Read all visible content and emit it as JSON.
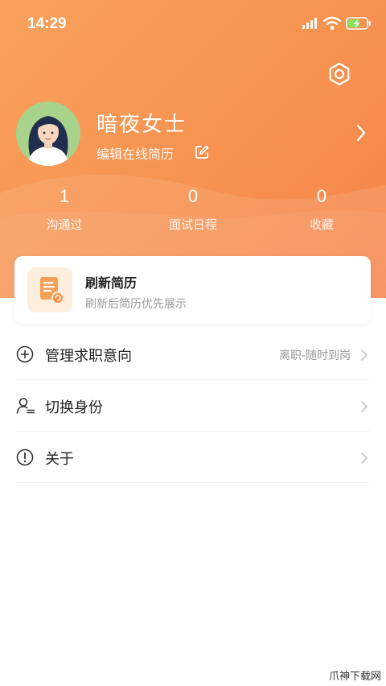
{
  "status_bar": {
    "time": "14:29"
  },
  "profile": {
    "name": "暗夜女士",
    "edit_label": "编辑在线简历"
  },
  "stats": [
    {
      "value": "1",
      "label": "沟通过"
    },
    {
      "value": "0",
      "label": "面试日程"
    },
    {
      "value": "0",
      "label": "收藏"
    }
  ],
  "refresh_card": {
    "title": "刷新简历",
    "subtitle": "刷新后简历优先展示"
  },
  "menu": {
    "items": [
      {
        "label": "管理求职意向",
        "value": "离职-随时到岗",
        "icon": "plus-circle-icon"
      },
      {
        "label": "切换身份",
        "value": "",
        "icon": "switch-user-icon"
      },
      {
        "label": "关于",
        "value": "",
        "icon": "info-circle-icon"
      }
    ]
  },
  "watermark": "爪神下载网",
  "colors": {
    "accent": "#f79552",
    "background": "#ffffff",
    "muted_text": "#999999"
  }
}
